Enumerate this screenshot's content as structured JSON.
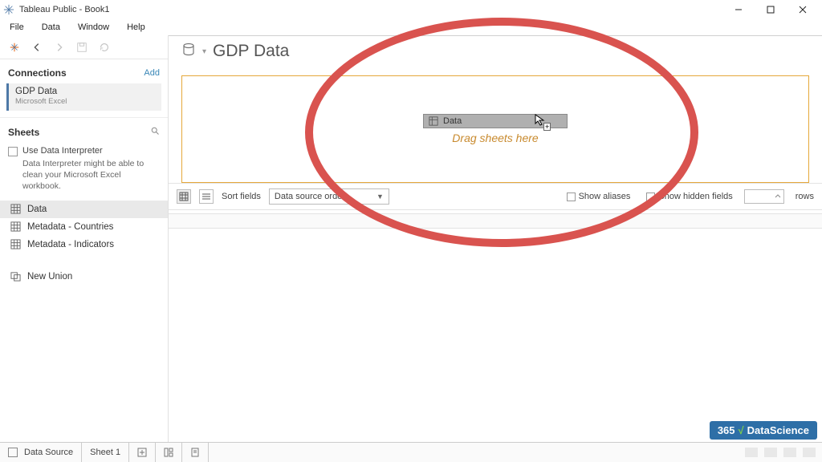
{
  "window": {
    "title": "Tableau Public - Book1"
  },
  "menu": {
    "file": "File",
    "data": "Data",
    "window": "Window",
    "help": "Help"
  },
  "sidebar": {
    "connections": {
      "heading": "Connections",
      "add": "Add",
      "items": [
        {
          "name": "GDP Data",
          "type": "Microsoft Excel"
        }
      ]
    },
    "sheets": {
      "heading": "Sheets",
      "use_interpreter": "Use Data Interpreter",
      "interpreter_hint": "Data Interpreter might be able to clean your Microsoft Excel workbook.",
      "items": [
        {
          "label": "Data"
        },
        {
          "label": "Metadata - Countries"
        },
        {
          "label": "Metadata - Indicators"
        }
      ],
      "new_union": "New Union"
    }
  },
  "main": {
    "datasource_title": "GDP Data",
    "drag_hint": "Drag sheets here",
    "dragged_item": "Data",
    "sort_label": "Sort fields",
    "sort_value": "Data source order",
    "show_aliases": "Show aliases",
    "show_hidden": "Show hidden fields",
    "rows_label": "rows"
  },
  "bottom": {
    "data_source": "Data Source",
    "sheet1": "Sheet 1"
  },
  "badge": {
    "prefix": "365",
    "suffix": "DataScience"
  }
}
